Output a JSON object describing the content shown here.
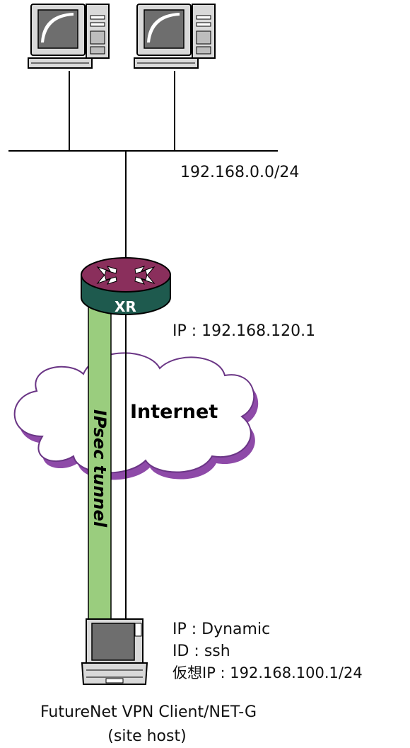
{
  "network": {
    "lan_subnet": "192.168.0.0/24"
  },
  "router": {
    "name": "XR",
    "ip_label": "IP : 192.168.120.1"
  },
  "cloud": {
    "label": "Internet"
  },
  "tunnel": {
    "label": "IPsec tunnel"
  },
  "client": {
    "ip_label": "IP : Dynamic",
    "id_label": "ID : ssh",
    "virtual_ip_label": "仮想IP : 192.168.100.1/24",
    "name_line1": "FutureNet VPN Client/NET-G",
    "name_line2": "(site host)"
  },
  "colors": {
    "router_top": "#8a2f5c",
    "router_side": "#1e5a4e",
    "tunnel": "#9acd7e",
    "cloud_fill": "#ffffff",
    "cloud_shadow": "#8e4aa8",
    "cloud_stroke": "#6a3585"
  }
}
